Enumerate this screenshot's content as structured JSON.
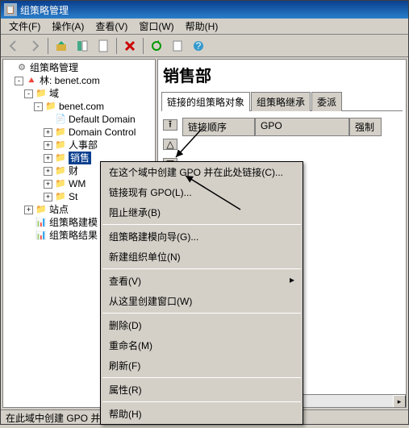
{
  "window": {
    "title": "组策略管理"
  },
  "menubar": {
    "file": "文件(F)",
    "action": "操作(A)",
    "view": "查看(V)",
    "window": "窗口(W)",
    "help": "帮助(H)"
  },
  "tree": {
    "root": "组策略管理",
    "forest": "林: benet.com",
    "domains": "域",
    "domain": "benet.com",
    "items": {
      "default_domain": "Default Domain",
      "domain_control": "Domain Control",
      "hr": "人事部",
      "sales": "销售部",
      "finance": "财务部",
      "wm": "WM",
      "st": "St"
    },
    "sites": "站点",
    "gpmodel": "组策略建模",
    "gpresult": "组策略结果"
  },
  "right": {
    "title": "销售部",
    "tabs": {
      "linked": "链接的组策略对象",
      "inherit": "组策略继承",
      "delegate": "委派"
    },
    "columns": {
      "link_order": "链接顺序",
      "gpo": "GPO",
      "forced": "强制"
    }
  },
  "context_menu": {
    "create_link": "在这个域中创建 GPO 并在此处链接(C)...",
    "link_existing": "链接现有 GPO(L)...",
    "block_inherit": "阻止继承(B)",
    "gp_modeling": "组策略建模向导(G)...",
    "new_ou": "新建组织单位(N)",
    "view": "查看(V)",
    "new_window": "从这里创建窗口(W)",
    "delete": "删除(D)",
    "rename": "重命名(M)",
    "refresh": "刷新(F)",
    "properties": "属性(R)",
    "help": "帮助(H)"
  },
  "statusbar": {
    "text": "在此域中创建 GPO 并将其链接到此容器"
  }
}
